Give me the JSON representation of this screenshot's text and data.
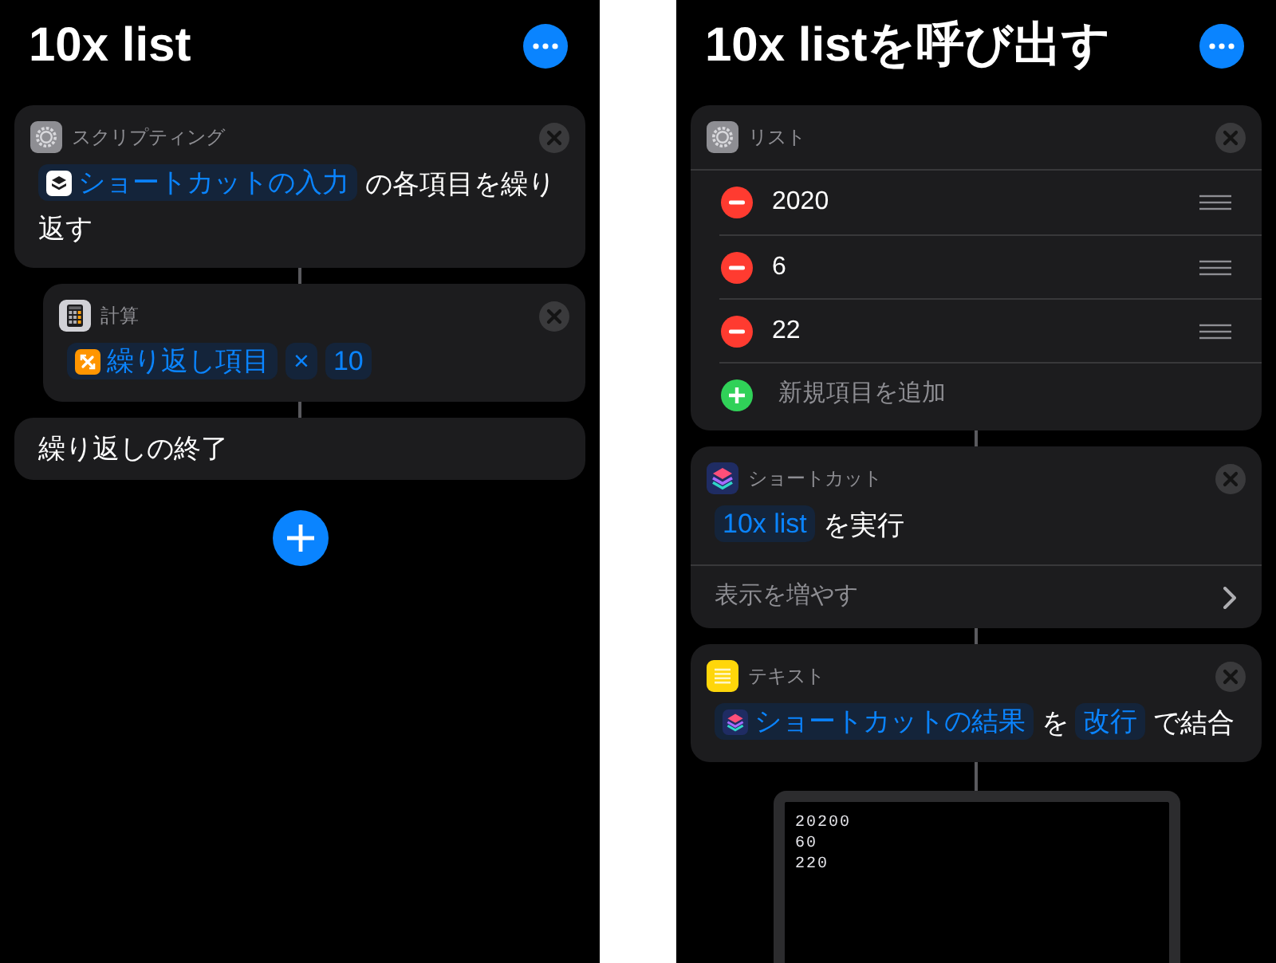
{
  "screens": [
    {
      "title": "10x list",
      "actions": [
        {
          "kind": "repeat",
          "header": "スクリプティング",
          "parts": [
            {
              "kind": "input",
              "text": "ショートカットの入力"
            },
            {
              "kind": "text",
              "text": "の各項目を繰り返す"
            }
          ],
          "children": [
            {
              "kind": "calculate",
              "header": "計算",
              "parts": [
                {
                  "kind": "loop",
                  "text": "繰り返し項目"
                },
                {
                  "kind": "token",
                  "text": "×"
                },
                {
                  "kind": "token",
                  "text": "10"
                }
              ]
            }
          ]
        },
        {
          "kind": "end",
          "text": "繰り返しの終了"
        },
        {
          "kind": "add"
        }
      ]
    },
    {
      "title": "10x listを呼び出す",
      "actions": [
        {
          "kind": "list",
          "header": "リスト",
          "items": [
            "2020",
            "6",
            "22"
          ],
          "add_label": "新規項目を追加"
        },
        {
          "kind": "shortcut",
          "header": "ショートカット",
          "parts": [
            {
              "kind": "token",
              "text": "10x list"
            },
            {
              "kind": "text",
              "text": "を実行"
            }
          ],
          "more": "表示を増やす"
        },
        {
          "kind": "text",
          "header": "テキスト",
          "parts": [
            {
              "kind": "result",
              "text": "ショートカットの結果"
            },
            {
              "kind": "text",
              "text": "を"
            },
            {
              "kind": "token",
              "text": "改行"
            },
            {
              "kind": "text",
              "text": "で結合"
            }
          ]
        },
        {
          "kind": "output",
          "lines": [
            "20200",
            "60",
            "220"
          ]
        }
      ]
    }
  ]
}
